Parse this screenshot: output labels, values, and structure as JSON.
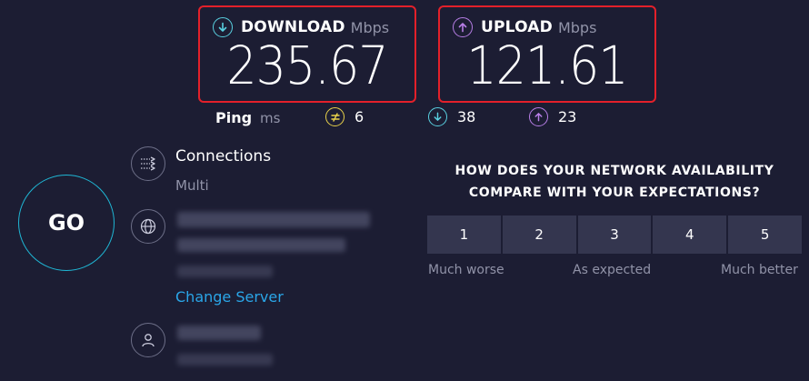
{
  "download": {
    "label": "DOWNLOAD",
    "unit": "Mbps",
    "value": "235.67",
    "icon": "arrow-down-circle-icon",
    "color": "#59d0e0"
  },
  "upload": {
    "label": "UPLOAD",
    "unit": "Mbps",
    "value": "121.61",
    "icon": "arrow-up-circle-icon",
    "color": "#b77ee6"
  },
  "ping": {
    "label": "Ping",
    "unit": "ms",
    "idle": {
      "value": "6",
      "icon": "ping-idle-icon",
      "color": "#e8d14a"
    },
    "download": {
      "value": "38",
      "icon": "arrow-down-circle-icon",
      "color": "#59d0e0"
    },
    "upload": {
      "value": "23",
      "icon": "arrow-up-circle-icon",
      "color": "#b77ee6"
    }
  },
  "go_button": {
    "label": "GO"
  },
  "connections": {
    "title": "Connections",
    "value": "Multi",
    "icon": "connections-icon"
  },
  "server": {
    "icon": "globe-icon",
    "change_label": "Change Server"
  },
  "provider": {
    "icon": "user-icon"
  },
  "survey": {
    "question_line1": "HOW DOES YOUR NETWORK AVAILABILITY",
    "question_line2": "COMPARE WITH YOUR EXPECTATIONS?",
    "options": [
      "1",
      "2",
      "3",
      "4",
      "5"
    ],
    "scale_low": "Much worse",
    "scale_mid": "As expected",
    "scale_high": "Much better"
  },
  "colors": {
    "background": "#1c1d33",
    "highlight_border": "#e3202a",
    "go_ring": "#1fb6d4",
    "link": "#2aa6e8"
  }
}
